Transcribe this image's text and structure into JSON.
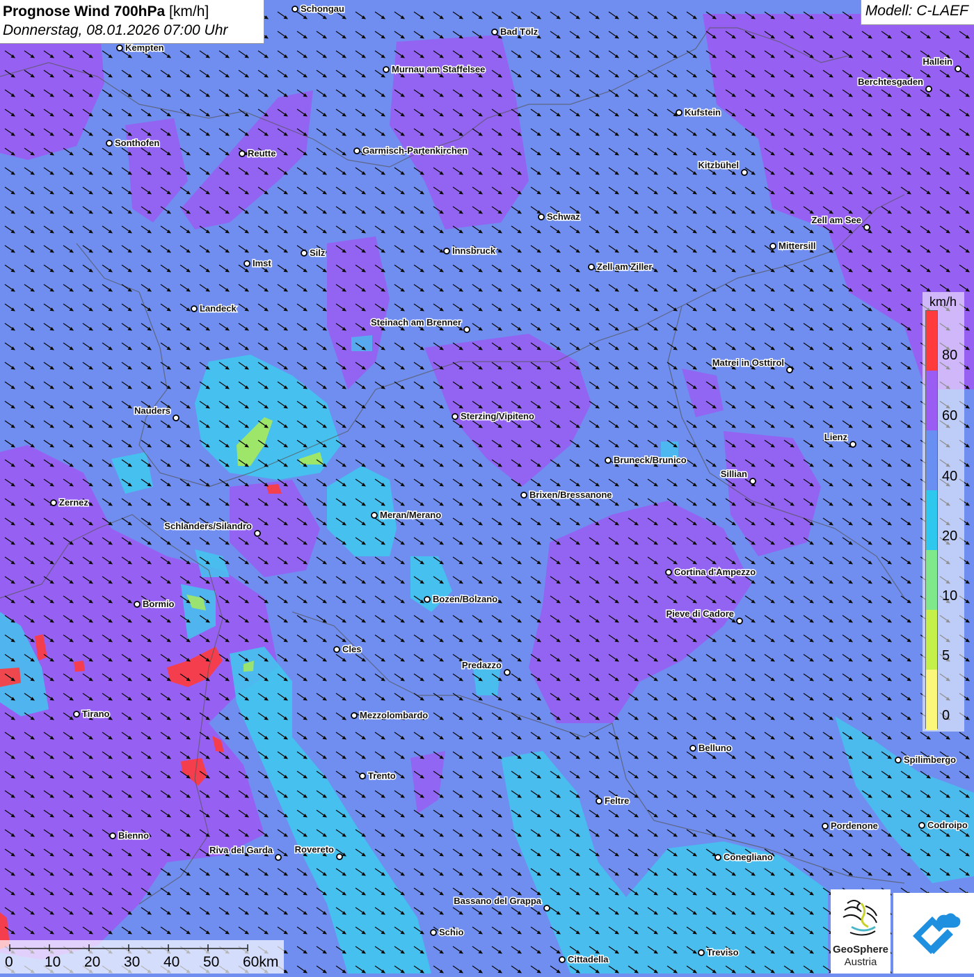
{
  "title": {
    "main": "Prognose Wind 700hPa",
    "unit": "[km/h]",
    "date": "Donnerstag, 08.01.2026 07:00 Uhr"
  },
  "model": "Modell: C-LAEF",
  "legend": {
    "unit": "km/h",
    "labels": [
      "80",
      "60",
      "40",
      "20",
      "10",
      "5",
      "0"
    ],
    "colors": [
      "#ff3b3b",
      "#9a5cf2",
      "#6a8ff2",
      "#2ec7ee",
      "#7ee88a",
      "#c5f04a",
      "#fbf77a"
    ]
  },
  "scalebar": {
    "labels": [
      "0",
      "10",
      "20",
      "30",
      "40",
      "50",
      "60km"
    ]
  },
  "logos": {
    "geosphere_name": "GeoSphere",
    "geosphere_sub": "Austria"
  },
  "colors": {
    "base": "#6f8ef0",
    "purple": "#9a5cf2",
    "cyan": "#3fc9ee",
    "green": "#a7ea5a",
    "red": "#ff3b3b"
  },
  "wind": {
    "direction": "northwest-to-southeast"
  },
  "cities": [
    {
      "name": "Schongau"
    },
    {
      "name": "Bad Tölz"
    },
    {
      "name": "Kempten"
    },
    {
      "name": "Murnau am Staffelsee"
    },
    {
      "name": "Hallein"
    },
    {
      "name": "Berchtesgaden"
    },
    {
      "name": "Kufstein"
    },
    {
      "name": "Sonthofen"
    },
    {
      "name": "Reutte"
    },
    {
      "name": "Garmisch-Partenkirchen"
    },
    {
      "name": "Kitzbühel"
    },
    {
      "name": "Schwaz"
    },
    {
      "name": "Zell am See"
    },
    {
      "name": "Mittersill"
    },
    {
      "name": "Silz"
    },
    {
      "name": "Innsbruck"
    },
    {
      "name": "Imst"
    },
    {
      "name": "Zell am Ziller"
    },
    {
      "name": "Landeck"
    },
    {
      "name": "Steinach am Brenner"
    },
    {
      "name": "Matrei in Osttirol"
    },
    {
      "name": "Nauders"
    },
    {
      "name": "Sterzing/Vipiteno"
    },
    {
      "name": "Lienz"
    },
    {
      "name": "Bruneck/Brunico"
    },
    {
      "name": "Sillian"
    },
    {
      "name": "Zernez"
    },
    {
      "name": "Brixen/Bressanone"
    },
    {
      "name": "Meran/Merano"
    },
    {
      "name": "Schlanders/Silandro"
    },
    {
      "name": "Cortina d'Ampezzo"
    },
    {
      "name": "Bozen/Bolzano"
    },
    {
      "name": "Bormio"
    },
    {
      "name": "Pieve di Cadore"
    },
    {
      "name": "Cles"
    },
    {
      "name": "Predazzo"
    },
    {
      "name": "Tirano"
    },
    {
      "name": "Mezzolombardo"
    },
    {
      "name": "Belluno"
    },
    {
      "name": "Spilimbergo"
    },
    {
      "name": "Trento"
    },
    {
      "name": "Feltre"
    },
    {
      "name": "Pordenone"
    },
    {
      "name": "Codroipo"
    },
    {
      "name": "Bienno"
    },
    {
      "name": "Riva del Garda"
    },
    {
      "name": "Rovereto"
    },
    {
      "name": "Conegliano"
    },
    {
      "name": "Bassano del Grappa"
    },
    {
      "name": "Schio"
    },
    {
      "name": "Treviso"
    },
    {
      "name": "Cittadella"
    }
  ]
}
